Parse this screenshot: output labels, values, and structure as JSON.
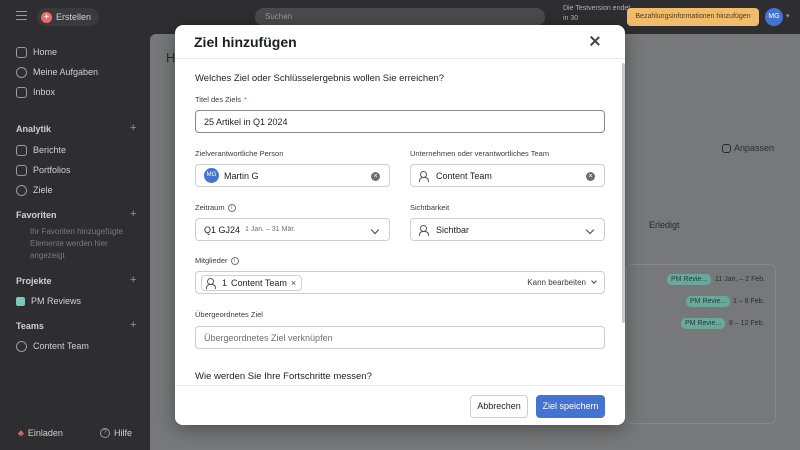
{
  "topbar": {
    "create_label": "Erstellen",
    "search_placeholder": "Suchen",
    "trial_text": "Die Testversion endet in 30",
    "upgrade_label": "Bezahlungsinformationen hinzufügen",
    "user_initials": "MG"
  },
  "sidebar": {
    "nav": [
      {
        "label": "Home"
      },
      {
        "label": "Meine Aufgaben"
      },
      {
        "label": "Inbox"
      }
    ],
    "analytics_heading": "Analytik",
    "analytics_items": [
      {
        "label": "Berichte"
      },
      {
        "label": "Portfolios"
      },
      {
        "label": "Ziele"
      }
    ],
    "favorites_heading": "Favoriten",
    "favorites_hint": "Ihr Favoriten hinzugefügte Elemente werden hier angezeigt",
    "projects_heading": "Projekte",
    "project_item": "PM Reviews",
    "teams_heading": "Teams",
    "team_item": "Content Team",
    "invite_label": "Einladen",
    "help_label": "Hilfe"
  },
  "main": {
    "title_letter": "H",
    "customize_label": "Anpassen",
    "done_label": "Erledigt",
    "rows": [
      {
        "tag": "PM Revie...",
        "dates": "11 Jan. – 2 Feb."
      },
      {
        "tag": "PM Revie...",
        "dates": "1 – 8 Feb."
      },
      {
        "tag": "PM Revie...",
        "dates": "8 – 12 Feb."
      }
    ]
  },
  "modal": {
    "title": "Ziel hinzufügen",
    "question": "Welches Ziel oder Schlüsselergebnis wollen Sie erreichen?",
    "goal_title_label": "Titel des Ziels",
    "required_marker": "*",
    "goal_title_value": "25 Artikel in Q1 2024",
    "owner_label": "Zielverantwortliche Person",
    "owner_initials": "MG",
    "owner_name": "Martin G",
    "team_label": "Unternehmen oder verantwortliches Team",
    "team_value": "Content Team",
    "period_label": "Zeitraum",
    "period_value": "Q1 GJ24",
    "period_range": "1 Jan. – 31 Mär.",
    "visibility_label": "Sichtbarkeit",
    "visibility_value": "Sichtbar",
    "members_label": "Mitglieder",
    "member_count": "1",
    "member_chip": "Content Team",
    "member_permission": "Kann bearbeiten",
    "parent_label": "Übergeordnetes Ziel",
    "parent_placeholder": "Übergeordnetes Ziel verknüpfen",
    "progress_question": "Wie werden Sie Ihre Fortschritte messen?",
    "cancel_label": "Abbrechen",
    "save_label": "Ziel speichern",
    "close_glyph": "×"
  },
  "colors": {
    "primary": "#4573d2",
    "upgrade": "#f1bd6c",
    "create": "#f06a6a",
    "tag": "#6aa89c"
  }
}
